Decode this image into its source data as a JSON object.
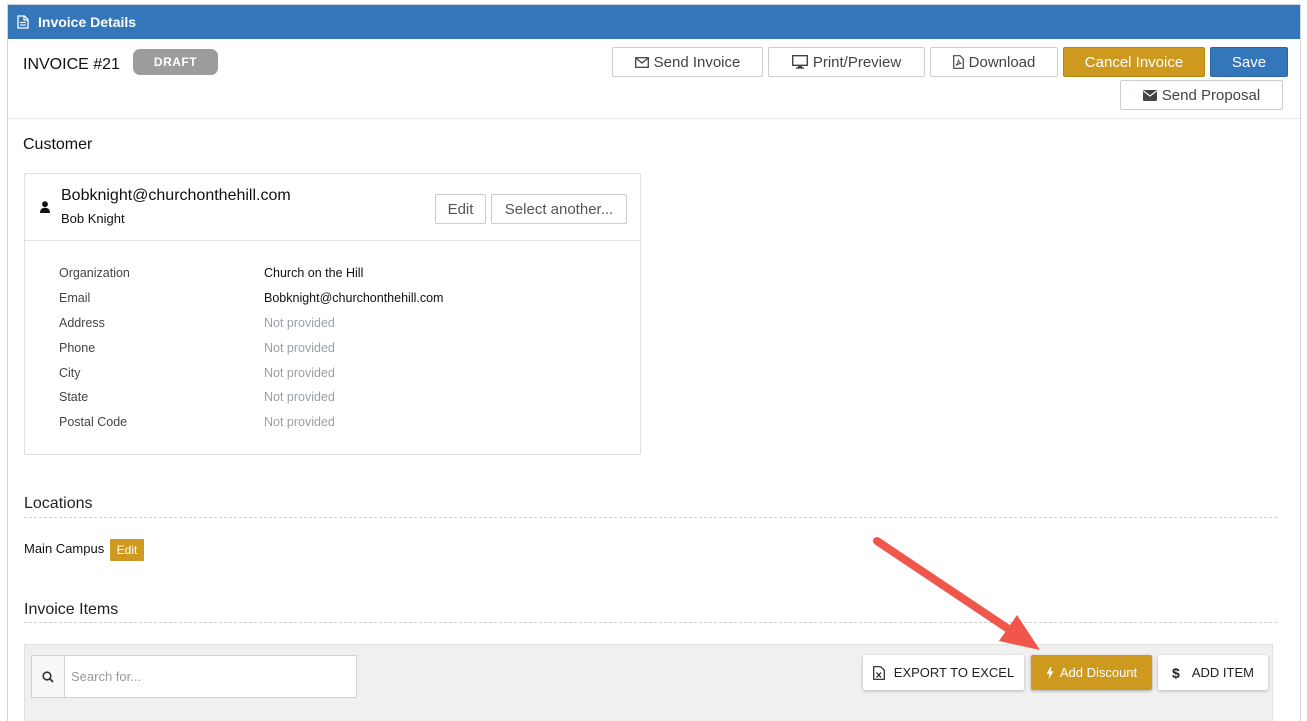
{
  "panel": {
    "title": "Invoice Details",
    "header_icon": "document-icon",
    "accent_color": "#3376b9",
    "gold_color": "#cd9a1f"
  },
  "invoice": {
    "number": "INVOICE #21",
    "status": "DRAFT"
  },
  "actions": {
    "send_invoice": "Send Invoice",
    "print_preview": "Print/Preview",
    "download": "Download",
    "cancel_invoice": "Cancel Invoice",
    "save": "Save",
    "send_proposal": "Send Proposal"
  },
  "customer": {
    "section_title": "Customer",
    "email": "Bobknight@churchonthehill.com",
    "name": "Bob Knight",
    "edit_label": "Edit",
    "select_another_label": "Select another...",
    "details": [
      {
        "label": "Organization",
        "value": "Church on the Hill"
      },
      {
        "label": "Email",
        "value": "Bobknight@churchonthehill.com"
      },
      {
        "label": "Address",
        "value": "Not provided"
      },
      {
        "label": "Phone",
        "value": "Not provided"
      },
      {
        "label": "City",
        "value": "Not provided"
      },
      {
        "label": "State",
        "value": "Not provided"
      },
      {
        "label": "Postal Code",
        "value": "Not provided"
      }
    ]
  },
  "locations": {
    "section_title": "Locations",
    "items": [
      {
        "name": "Main Campus",
        "edit_label": "Edit"
      }
    ]
  },
  "invoice_items": {
    "section_title": "Invoice Items",
    "search_placeholder": "Search for...",
    "export_label": "EXPORT TO EXCEL",
    "add_discount_label": "Add Discount",
    "add_item_label": "ADD ITEM"
  },
  "annotation": {
    "arrow_color": "#f0574a"
  }
}
